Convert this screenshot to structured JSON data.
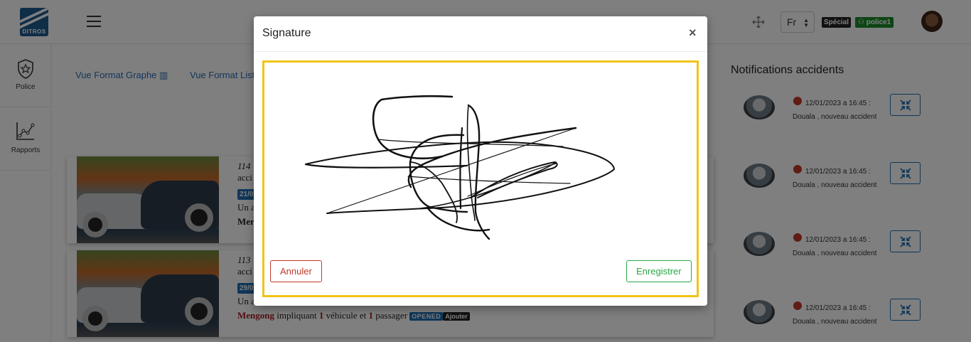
{
  "header": {
    "logo_text": "DITROS",
    "language": "Fr",
    "role_badge": "Spécial",
    "user_badge": "police1"
  },
  "sidebar": {
    "items": [
      {
        "label": "Police",
        "icon": "shield-star-icon"
      },
      {
        "label": "Rapports",
        "icon": "line-chart-icon"
      }
    ]
  },
  "main": {
    "view_links": {
      "graph": "Vue Format Graphe",
      "list": "Vue Format Liste"
    },
    "accidents": [
      {
        "number": "114",
        "line2": "acci",
        "date_badge": "21/0",
        "line3": "Un a",
        "line4": "Mer"
      },
      {
        "number": "113",
        "line2": "acci",
        "date_badge": "29/0",
        "line3": "Un a",
        "location": "Mengong",
        "text_impliquant": "impliquant",
        "vehicles": "1",
        "text_vehicule": "véhicule et",
        "passengers": "1",
        "text_passager": "passager",
        "status": "OPENED",
        "action": "Ajouter"
      }
    ]
  },
  "notifications": {
    "title": "Notifications accidents",
    "items": [
      {
        "text": "12/01/2023 a 16:45 : Douala , nouveau accident"
      },
      {
        "text": "12/01/2023 a 16:45 : Douala , nouveau accident"
      },
      {
        "text": "12/01/2023 a 16:45 : Douala , nouveau accident"
      },
      {
        "text": "12/01/2023 a 16:45 : Douala , nouveau accident"
      }
    ]
  },
  "modal": {
    "title": "Signature",
    "close": "×",
    "cancel_label": "Annuler",
    "save_label": "Enregistrer",
    "frame_color": "#f2c318"
  },
  "colors": {
    "link": "#2a6db5",
    "danger": "#c0392b",
    "success": "#28a745",
    "primary_badge": "#1f6fb2"
  }
}
